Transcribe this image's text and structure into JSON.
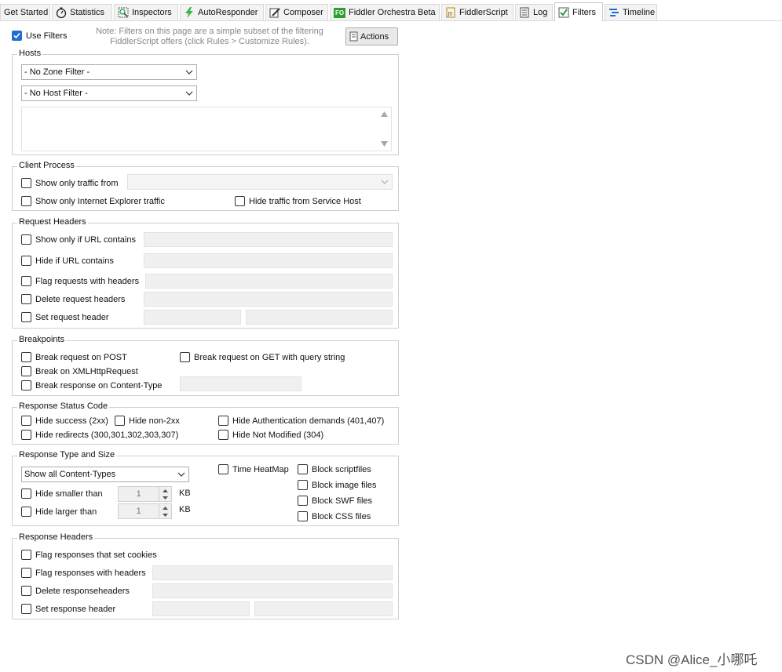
{
  "tabs": [
    {
      "label": "Get Started",
      "icon": "none"
    },
    {
      "label": "Statistics",
      "icon": "stopwatch-icon"
    },
    {
      "label": "Inspectors",
      "icon": "inspector-icon"
    },
    {
      "label": "AutoResponder",
      "icon": "lightning-icon"
    },
    {
      "label": "Composer",
      "icon": "compose-icon"
    },
    {
      "label": "Fiddler Orchestra Beta",
      "icon": "fo-icon",
      "icon_text": "FO"
    },
    {
      "label": "FiddlerScript",
      "icon": "script-icon",
      "icon_text": "JS"
    },
    {
      "label": "Log",
      "icon": "log-icon"
    },
    {
      "label": "Filters",
      "icon": "checkmark-icon",
      "active": true
    },
    {
      "label": "Timeline",
      "icon": "timeline-icon"
    }
  ],
  "top": {
    "use_filters": "Use Filters",
    "note": "Note: Filters on this page are a simple subset of the filtering FiddlerScript offers (click Rules > Customize Rules).",
    "actions": "Actions"
  },
  "hosts": {
    "title": "Hosts",
    "zone_filter": "- No Zone Filter -",
    "host_filter": "- No Host Filter -"
  },
  "client_process": {
    "title": "Client Process",
    "show_only_from": "Show only traffic from",
    "show_only_ie": "Show only Internet Explorer traffic",
    "hide_service_host": "Hide traffic from Service Host"
  },
  "request_headers": {
    "title": "Request Headers",
    "show_if_url": "Show only if URL contains",
    "hide_if_url": "Hide if URL contains",
    "flag_headers": "Flag requests with headers",
    "delete_headers": "Delete request headers",
    "set_header": "Set request header"
  },
  "breakpoints": {
    "title": "Breakpoints",
    "post": "Break request on POST",
    "get_query": "Break request on GET with query string",
    "xhr": "Break on XMLHttpRequest",
    "content_type": "Break response on Content-Type"
  },
  "status_code": {
    "title": "Response Status Code",
    "hide_success": "Hide success (2xx)",
    "hide_non2xx": "Hide non-2xx",
    "hide_auth": "Hide Authentication demands (401,407)",
    "hide_redirects": "Hide redirects (300,301,302,303,307)",
    "hide_not_modified": "Hide Not Modified (304)"
  },
  "type_size": {
    "title": "Response Type and Size",
    "content_types": "Show all Content-Types",
    "time_heatmap": "Time HeatMap",
    "block_script": "Block scriptfiles",
    "block_image": "Block image files",
    "block_swf": "Block SWF files",
    "block_css": "Block CSS files",
    "hide_smaller": "Hide smaller than",
    "hide_larger": "Hide larger than",
    "smaller_value": "1",
    "larger_value": "1",
    "unit": "KB"
  },
  "response_headers": {
    "title": "Response Headers",
    "flag_cookies": "Flag responses that set cookies",
    "flag_headers": "Flag responses with headers",
    "delete_headers": "Delete responseheaders",
    "set_header": "Set response header"
  },
  "watermark": "CSDN @Alice_小哪吒",
  "colors": {
    "accent": "#1f6dd6",
    "disabled_field": "#f0f0f0",
    "border": "#cfcfcf"
  }
}
